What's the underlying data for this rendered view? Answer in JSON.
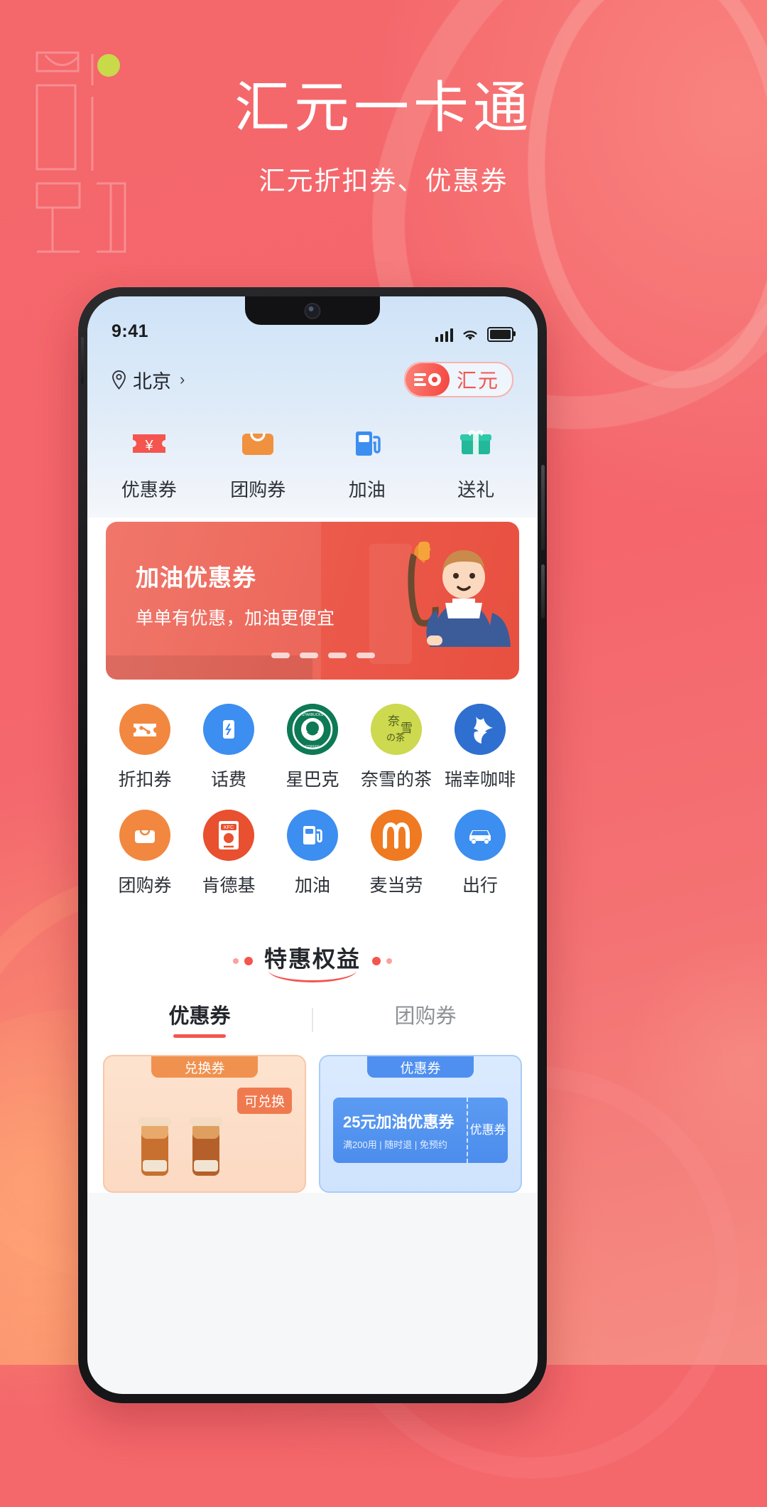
{
  "poster": {
    "title": "汇元一卡通",
    "subtitle": "汇元折扣券、优惠券"
  },
  "phone": {
    "status_bar": {
      "time": "9:41",
      "signal_icon": "signal-bars-icon",
      "wifi_icon": "wifi-icon",
      "battery_icon": "battery-icon"
    },
    "header": {
      "location_icon": "location-pin-icon",
      "location": "北京",
      "chevron": "›",
      "logo_text": "汇元"
    },
    "categories": [
      {
        "label": "优惠券",
        "icon": "coupon-ticket-icon",
        "color": "#f4554f"
      },
      {
        "label": "团购券",
        "icon": "group-buy-bag-icon",
        "color": "#f09140"
      },
      {
        "label": "加油",
        "icon": "fuel-pump-icon",
        "color": "#3c8ef0"
      },
      {
        "label": "送礼",
        "icon": "gift-box-icon",
        "color": "#23b89a"
      }
    ],
    "banner": {
      "title": "加油优惠券",
      "subtitle": "单单有优惠，加油更便宜",
      "dots": 4
    },
    "brands_row1": [
      {
        "label": "折扣券",
        "icon": "discount-ticket-icon",
        "color": "#f2873f"
      },
      {
        "label": "话费",
        "icon": "phone-bill-icon",
        "color": "#3c8ef0"
      },
      {
        "label": "星巴克",
        "icon": "starbucks-icon",
        "color": "#0d7a55"
      },
      {
        "label": "奈雪的茶",
        "icon": "naixue-tea-icon",
        "color": "#cdd94e"
      },
      {
        "label": "瑞幸咖啡",
        "icon": "luckin-coffee-icon",
        "color": "#2f6fd0"
      }
    ],
    "brands_row2": [
      {
        "label": "团购券",
        "icon": "group-buy-bag-icon",
        "color": "#f2873f"
      },
      {
        "label": "肯德基",
        "icon": "kfc-icon",
        "color": "#e8502f"
      },
      {
        "label": "加油",
        "icon": "fuel-pump-icon",
        "color": "#3c8ef0"
      },
      {
        "label": "麦当劳",
        "icon": "mcdonalds-icon",
        "color": "#ef7a21"
      },
      {
        "label": "出行",
        "icon": "car-travel-icon",
        "color": "#3c8ef0"
      }
    ],
    "section": {
      "title": "特惠权益"
    },
    "tabs": [
      {
        "label": "优惠券",
        "active": true
      },
      {
        "label": "团购券",
        "active": false
      }
    ],
    "cards": [
      {
        "tag": "兑换券",
        "badge": "可兑换",
        "kind": "drink-coupon"
      },
      {
        "tag": "优惠券",
        "ticket_title": "25元加油优惠券",
        "ticket_sub": "满200用 | 随时退 | 免预约",
        "ticket_side": "优惠券",
        "kind": "fuel-coupon"
      }
    ]
  },
  "theme": {
    "accent": "#f4554f",
    "poster_bg": "#f4676b",
    "lime_dot": "#c8d94a"
  }
}
